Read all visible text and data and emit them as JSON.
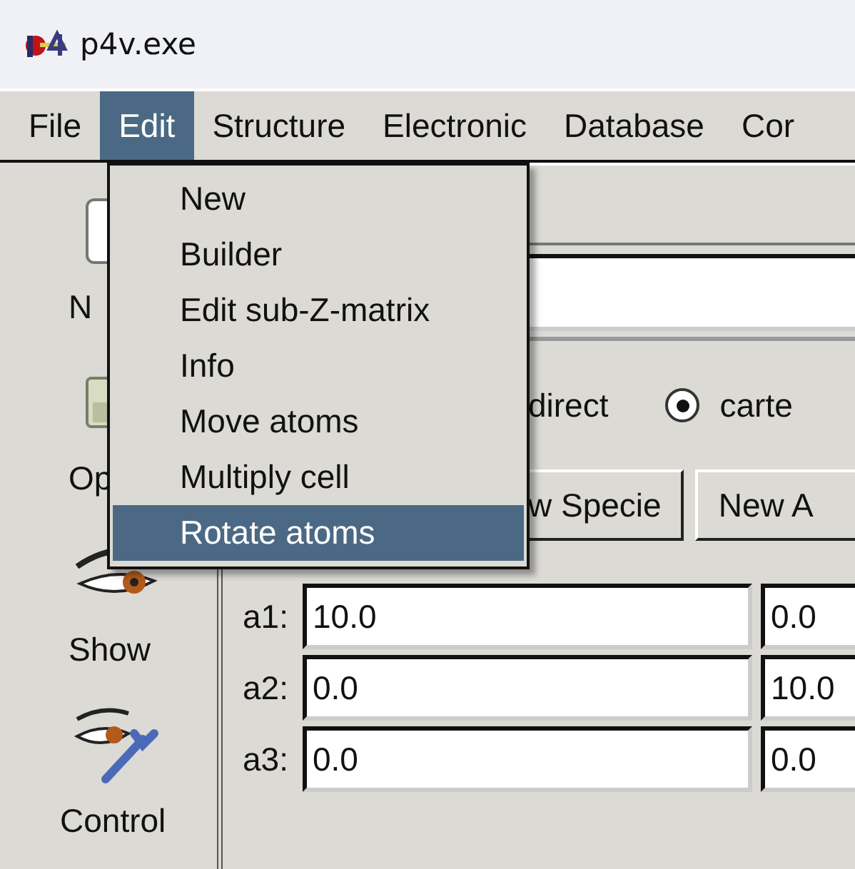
{
  "window": {
    "title": "p4v.exe"
  },
  "menubar": [
    {
      "label": "File",
      "selected": false
    },
    {
      "label": "Edit",
      "selected": true
    },
    {
      "label": "Structure",
      "selected": false
    },
    {
      "label": "Electronic",
      "selected": false
    },
    {
      "label": "Database",
      "selected": false
    },
    {
      "label": "Cor",
      "selected": false
    }
  ],
  "edit_menu": [
    {
      "label": "New",
      "selected": false
    },
    {
      "label": "Builder",
      "selected": false
    },
    {
      "label": "Edit sub-Z-matrix",
      "selected": false
    },
    {
      "label": "Info",
      "selected": false
    },
    {
      "label": "Move atoms",
      "selected": false
    },
    {
      "label": "Multiply cell",
      "selected": false
    },
    {
      "label": "Rotate atoms",
      "selected": true
    }
  ],
  "sidebar": {
    "items": [
      {
        "label": "N"
      },
      {
        "label": "Op"
      },
      {
        "label": "Show"
      },
      {
        "label": "Control"
      }
    ]
  },
  "coordinates": [
    {
      "label": "direct"
    },
    {
      "label": "carte",
      "selected": true
    }
  ],
  "buttons": [
    "w Specie",
    "New A"
  ],
  "editor": {
    "rows": [
      {
        "label": "a1:",
        "values": [
          "10.0",
          "0.0"
        ]
      },
      {
        "label": "a2:",
        "values": [
          "0.0",
          "10.0"
        ]
      },
      {
        "label": "a3:",
        "values": [
          "0.0",
          "0.0"
        ]
      }
    ]
  }
}
